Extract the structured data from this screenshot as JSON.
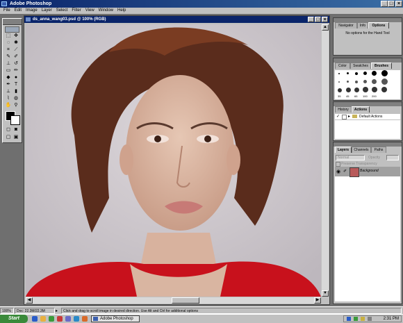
{
  "app": {
    "title": "Adobe Photoshop"
  },
  "menu": [
    "File",
    "Edit",
    "Image",
    "Layer",
    "Select",
    "Filter",
    "View",
    "Window",
    "Help"
  ],
  "document": {
    "title": "ds_anna_wang03.psd @ 100% (RGB)"
  },
  "palettes": {
    "options": {
      "tabs": [
        "Navigator",
        "Info",
        "Options"
      ],
      "message": "No options for the Hand Tool"
    },
    "brushes": {
      "tabs": [
        "Color",
        "Swatches",
        "Brushes"
      ],
      "size_labels": [
        "35",
        "45",
        "65",
        "100",
        "200"
      ]
    },
    "actions": {
      "tabs": [
        "History",
        "Actions"
      ],
      "item": "Default Actions"
    },
    "layers": {
      "tabs": [
        "Layers",
        "Channels",
        "Paths"
      ],
      "mode": "Normal",
      "opacity_label": "Opacity",
      "preserve": "Preserve Transparency",
      "layer_name": "Background"
    }
  },
  "status": {
    "zoom": "100%",
    "doc": "Doc: 22.3M/22.3M",
    "hint": "Click and drag to scroll image in desired direction. Use Alt and Ctrl for additional options"
  },
  "taskbar": {
    "start": "Start",
    "task": "Adobe Photoshop",
    "time": "2:31 PM"
  }
}
